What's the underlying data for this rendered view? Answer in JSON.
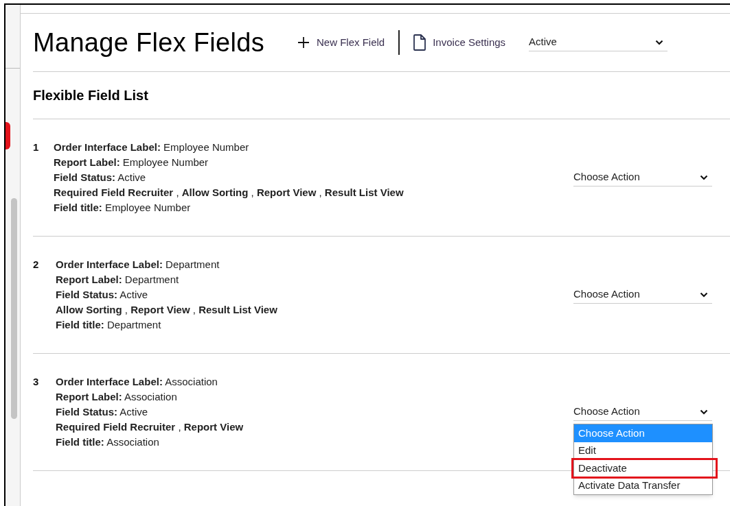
{
  "header": {
    "title": "Manage Flex Fields",
    "actions": [
      {
        "kind": "add",
        "label": "New Flex Field"
      },
      {
        "kind": "document",
        "label": "Invoice Settings"
      }
    ],
    "status_filter": {
      "value": "Active"
    }
  },
  "list": {
    "title": "Flexible Field List",
    "items": [
      {
        "number": "1",
        "lines": [
          "**Order Interface Label:** Employee Number",
          "**Report Label:** Employee Number",
          "**Field Status:** Active",
          "**Required Field Recruiter** , **Allow Sorting** , **Report View** , **Result List View**",
          "**Field title:** Employee Number"
        ],
        "action": {
          "value": "Choose Action"
        }
      },
      {
        "number": "2",
        "lines": [
          "**Order Interface Label:** Department",
          "**Report Label:** Department",
          "**Field Status:** Active",
          "**Allow Sorting** , **Report View** , **Result List View**",
          "**Field title:** Department"
        ],
        "action": {
          "value": "Choose Action"
        }
      },
      {
        "number": "3",
        "lines": [
          "**Order Interface Label:** Association",
          "**Report Label:** Association",
          "**Field Status:** Active",
          "**Required Field Recruiter** , **Report View**",
          "**Field title:** Association"
        ],
        "action": {
          "value": "Choose Action",
          "options": [
            {
              "label": "Choose Action",
              "selected": true,
              "highlighted": false
            },
            {
              "label": "Edit",
              "selected": false,
              "highlighted": false
            },
            {
              "label": "Deactivate",
              "selected": false,
              "highlighted": true
            },
            {
              "label": "Activate Data Transfer",
              "selected": false,
              "highlighted": false
            }
          ]
        }
      }
    ]
  }
}
